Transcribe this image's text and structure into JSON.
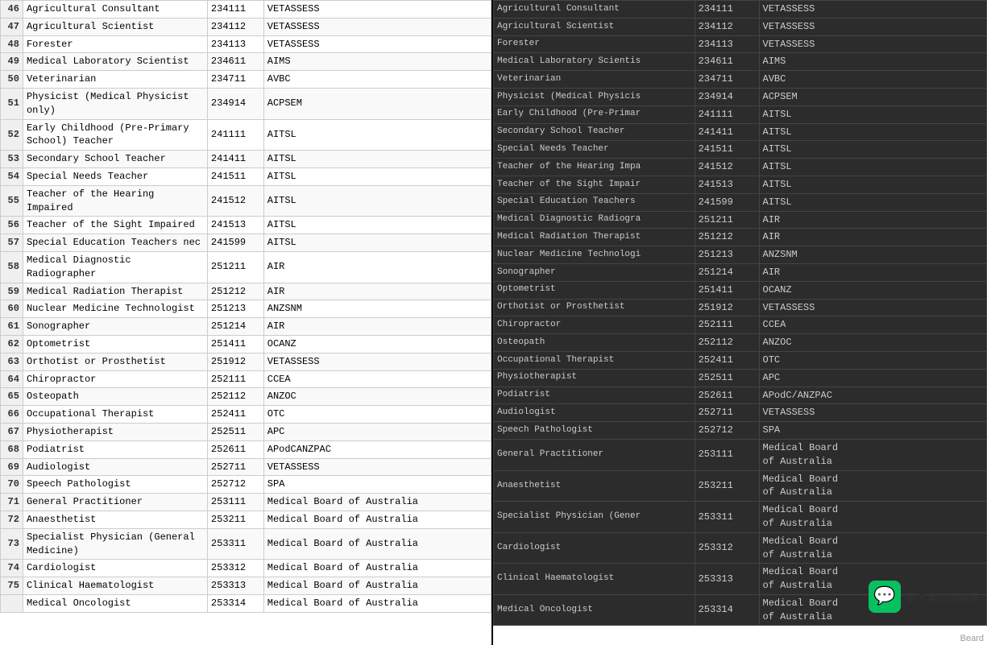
{
  "left": {
    "rows": [
      {
        "num": "46",
        "occupation": "Agricultural Consultant",
        "anzsco": "234111",
        "body": "VETASSESS"
      },
      {
        "num": "47",
        "occupation": "Agricultural Scientist",
        "anzsco": "234112",
        "body": "VETASSESS"
      },
      {
        "num": "48",
        "occupation": "Forester",
        "anzsco": "234113",
        "body": "VETASSESS"
      },
      {
        "num": "49",
        "occupation": "Medical Laboratory Scientist",
        "anzsco": "234611",
        "body": "AIMS"
      },
      {
        "num": "50",
        "occupation": "Veterinarian",
        "anzsco": "234711",
        "body": "AVBC"
      },
      {
        "num": "51",
        "occupation": "Physicist (Medical Physicist only)",
        "anzsco": "234914",
        "body": "ACPSEM"
      },
      {
        "num": "52",
        "occupation": "Early Childhood (Pre-Primary School) Teacher",
        "anzsco": "241111",
        "body": "AITSL"
      },
      {
        "num": "53",
        "occupation": "Secondary School Teacher",
        "anzsco": "241411",
        "body": "AITSL"
      },
      {
        "num": "54",
        "occupation": "Special Needs Teacher",
        "anzsco": "241511",
        "body": "AITSL"
      },
      {
        "num": "55",
        "occupation": "Teacher of the Hearing Impaired",
        "anzsco": "241512",
        "body": "AITSL"
      },
      {
        "num": "56",
        "occupation": "Teacher of the Sight Impaired",
        "anzsco": "241513",
        "body": "AITSL"
      },
      {
        "num": "57",
        "occupation": "Special Education Teachers nec",
        "anzsco": "241599",
        "body": "AITSL"
      },
      {
        "num": "58",
        "occupation": "Medical Diagnostic Radiographer",
        "anzsco": "251211",
        "body": "AIR"
      },
      {
        "num": "59",
        "occupation": "Medical Radiation Therapist",
        "anzsco": "251212",
        "body": "AIR"
      },
      {
        "num": "60",
        "occupation": "Nuclear Medicine Technologist",
        "anzsco": "251213",
        "body": "ANZSNM"
      },
      {
        "num": "61",
        "occupation": "Sonographer",
        "anzsco": "251214",
        "body": "AIR"
      },
      {
        "num": "62",
        "occupation": "Optometrist",
        "anzsco": "251411",
        "body": "OCANZ"
      },
      {
        "num": "63",
        "occupation": "Orthotist or Prosthetist",
        "anzsco": "251912",
        "body": "VETASSESS"
      },
      {
        "num": "64",
        "occupation": "Chiropractor",
        "anzsco": "252111",
        "body": "CCEA"
      },
      {
        "num": "65",
        "occupation": "Osteopath",
        "anzsco": "252112",
        "body": "ANZOC"
      },
      {
        "num": "66",
        "occupation": "Occupational Therapist",
        "anzsco": "252411",
        "body": "OTC"
      },
      {
        "num": "67",
        "occupation": "Physiotherapist",
        "anzsco": "252511",
        "body": "APC"
      },
      {
        "num": "68",
        "occupation": "Podiatrist",
        "anzsco": "252611",
        "body": "APodCANZPAC"
      },
      {
        "num": "69",
        "occupation": "Audiologist",
        "anzsco": "252711",
        "body": "VETASSESS"
      },
      {
        "num": "70",
        "occupation": "Speech Pathologist",
        "anzsco": "252712",
        "body": "SPA"
      },
      {
        "num": "71",
        "occupation": "General Practitioner",
        "anzsco": "253111",
        "body": "Medical Board of Australia"
      },
      {
        "num": "72",
        "occupation": "Anaesthetist",
        "anzsco": "253211",
        "body": "Medical Board of Australia"
      },
      {
        "num": "73",
        "occupation": "Specialist Physician (General Medicine)",
        "anzsco": "253311",
        "body": "Medical Board of Australia"
      },
      {
        "num": "74",
        "occupation": "Cardiologist",
        "anzsco": "253312",
        "body": "Medical Board of Australia"
      },
      {
        "num": "75",
        "occupation": "Clinical Haematologist",
        "anzsco": "253313",
        "body": "Medical Board of Australia"
      },
      {
        "num": "",
        "occupation": "Medical Oncologist",
        "anzsco": "253314",
        "body": "Medical Board of Australia"
      }
    ]
  },
  "right": {
    "rows": [
      {
        "occupation": "Agricultural Consultant",
        "anzsco": "234111",
        "body": "VETASSESS"
      },
      {
        "occupation": "Agricultural Scientist",
        "anzsco": "234112",
        "body": "VETASSESS"
      },
      {
        "occupation": "Forester",
        "anzsco": "234113",
        "body": "VETASSESS"
      },
      {
        "occupation": "Medical Laboratory Scientis",
        "anzsco": "234611",
        "body": "AIMS"
      },
      {
        "occupation": "Veterinarian",
        "anzsco": "234711",
        "body": "AVBC"
      },
      {
        "occupation": "Physicist (Medical Physicis",
        "anzsco": "234914",
        "body": "ACPSEM"
      },
      {
        "occupation": "Early Childhood (Pre-Primar",
        "anzsco": "241111",
        "body": "AITSL"
      },
      {
        "occupation": "Secondary School Teacher",
        "anzsco": "241411",
        "body": "AITSL"
      },
      {
        "occupation": "Special Needs Teacher",
        "anzsco": "241511",
        "body": "AITSL"
      },
      {
        "occupation": "Teacher of the Hearing Impa",
        "anzsco": "241512",
        "body": "AITSL"
      },
      {
        "occupation": "Teacher of the Sight Impair",
        "anzsco": "241513",
        "body": "AITSL"
      },
      {
        "occupation": "Special Education Teachers",
        "anzsco": "241599",
        "body": "AITSL"
      },
      {
        "occupation": "Medical Diagnostic Radiogra",
        "anzsco": "251211",
        "body": "AIR"
      },
      {
        "occupation": "Medical Radiation Therapist",
        "anzsco": "251212",
        "body": "AIR"
      },
      {
        "occupation": "Nuclear Medicine Technologi",
        "anzsco": "251213",
        "body": "ANZSNM"
      },
      {
        "occupation": "Sonographer",
        "anzsco": "251214",
        "body": "AIR"
      },
      {
        "occupation": "Optometrist",
        "anzsco": "251411",
        "body": "OCANZ"
      },
      {
        "occupation": "Orthotist or Prosthetist",
        "anzsco": "251912",
        "body": "VETASSESS"
      },
      {
        "occupation": "Chiropractor",
        "anzsco": "252111",
        "body": "CCEA"
      },
      {
        "occupation": "Osteopath",
        "anzsco": "252112",
        "body": "ANZOC"
      },
      {
        "occupation": "Occupational Therapist",
        "anzsco": "252411",
        "body": "OTC"
      },
      {
        "occupation": "Physiotherapist",
        "anzsco": "252511",
        "body": "APC"
      },
      {
        "occupation": "Podiatrist",
        "anzsco": "252611",
        "body": "APodC/ANZPAC"
      },
      {
        "occupation": "Audiologist",
        "anzsco": "252711",
        "body": "VETASSESS"
      },
      {
        "occupation": "Speech Pathologist",
        "anzsco": "252712",
        "body": "SPA"
      },
      {
        "occupation": "General Practitioner",
        "anzsco": "253111",
        "body": "Medical Board of Australia"
      },
      {
        "occupation": "Anaesthetist",
        "anzsco": "253211",
        "body": "Medical Board of Australia"
      },
      {
        "occupation": "Specialist Physician (Gener",
        "anzsco": "253311",
        "body": "Medical Board of Australia"
      },
      {
        "occupation": "Cardiologist",
        "anzsco": "253312",
        "body": "Medical Board of Australia"
      },
      {
        "occupation": "Clinical Haematologist",
        "anzsco": "253313",
        "body": "Medical Board of Australia"
      },
      {
        "occupation": "Medical Oncologist",
        "anzsco": "253314",
        "body": "Medical Board of Australia"
      }
    ]
  },
  "watermark": {
    "icon": "💬",
    "text": "墨尔本校园微报"
  },
  "beard_label1": "Beard",
  "beard_label2": "Beard"
}
